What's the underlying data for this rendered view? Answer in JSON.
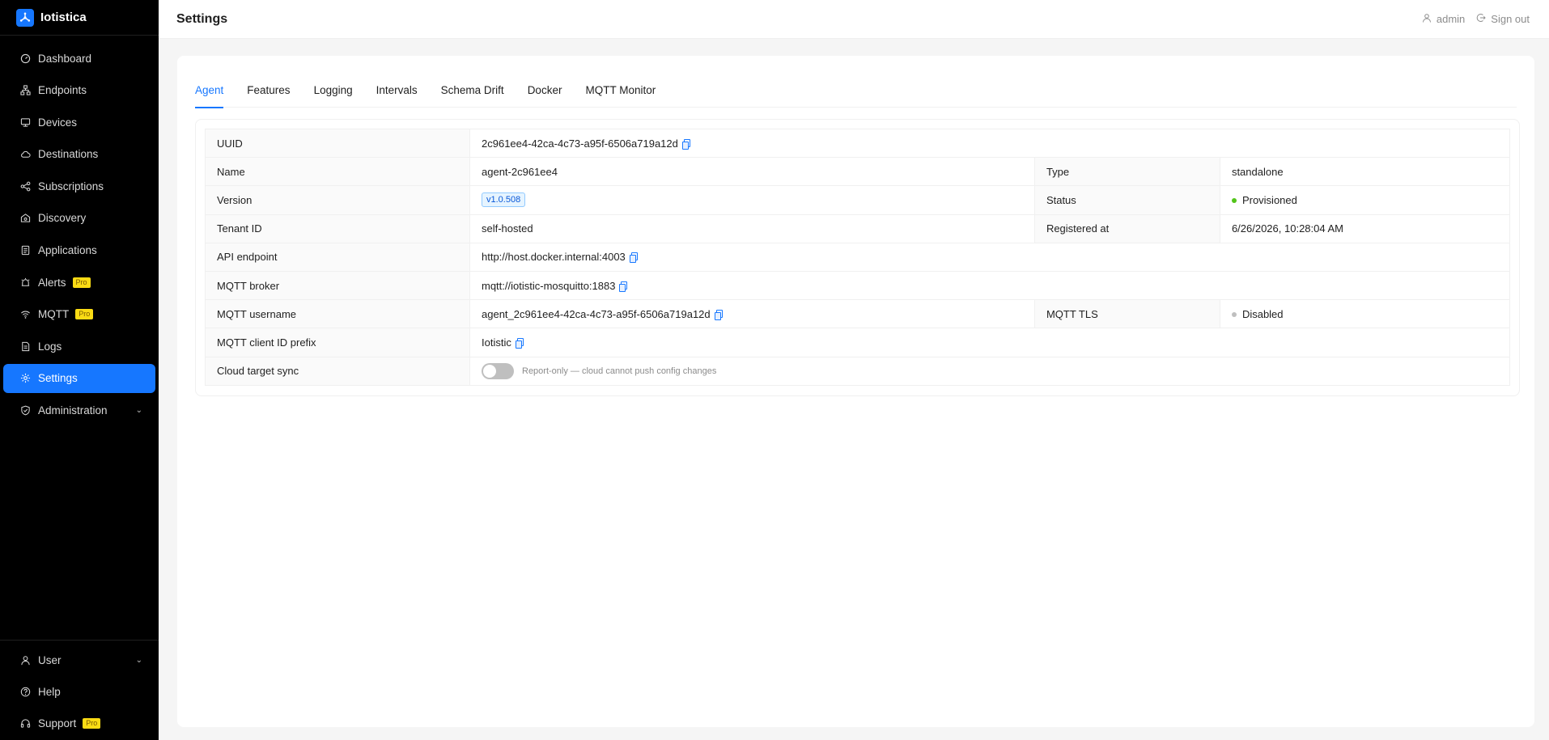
{
  "app": {
    "name": "Iotistica"
  },
  "sidebar": {
    "items": [
      {
        "label": "Dashboard",
        "icon": "dashboard-icon",
        "active": false
      },
      {
        "label": "Endpoints",
        "icon": "endpoints-icon",
        "active": false
      },
      {
        "label": "Devices",
        "icon": "devices-icon",
        "active": false
      },
      {
        "label": "Destinations",
        "icon": "cloud-icon",
        "active": false
      },
      {
        "label": "Subscriptions",
        "icon": "share-icon",
        "active": false
      },
      {
        "label": "Discovery",
        "icon": "discovery-icon",
        "active": false
      },
      {
        "label": "Applications",
        "icon": "applications-icon",
        "active": false
      },
      {
        "label": "Alerts",
        "icon": "alert-icon",
        "badge": "Pro",
        "active": false
      },
      {
        "label": "MQTT",
        "icon": "wifi-icon",
        "badge": "Pro",
        "active": false
      },
      {
        "label": "Logs",
        "icon": "logs-icon",
        "active": false
      },
      {
        "label": "Settings",
        "icon": "gear-icon",
        "active": true
      },
      {
        "label": "Administration",
        "icon": "shield-icon",
        "active": false,
        "expandable": true
      }
    ],
    "bottom": [
      {
        "label": "User",
        "icon": "user-icon",
        "expandable": true
      },
      {
        "label": "Help",
        "icon": "help-icon"
      },
      {
        "label": "Support",
        "icon": "headset-icon",
        "badge": "Pro"
      }
    ]
  },
  "header": {
    "title": "Settings",
    "user": "admin",
    "signout": "Sign out"
  },
  "tabs": [
    {
      "label": "Agent",
      "active": true
    },
    {
      "label": "Features",
      "active": false
    },
    {
      "label": "Logging",
      "active": false
    },
    {
      "label": "Intervals",
      "active": false
    },
    {
      "label": "Schema Drift",
      "active": false
    },
    {
      "label": "Docker",
      "active": false
    },
    {
      "label": "MQTT Monitor",
      "active": false
    }
  ],
  "agent": {
    "uuid_label": "UUID",
    "uuid": "2c961ee4-42ca-4c73-a95f-6506a719a12d",
    "name_label": "Name",
    "name": "agent-2c961ee4",
    "type_label": "Type",
    "type": "standalone",
    "version_label": "Version",
    "version": "v1.0.508",
    "status_label": "Status",
    "status": "Provisioned",
    "status_color": "#52c41a",
    "tenant_label": "Tenant ID",
    "tenant": "self-hosted",
    "registered_label": "Registered at",
    "registered": "6/26/2026, 10:28:04 AM",
    "api_label": "API endpoint",
    "api": "http://host.docker.internal:4003",
    "broker_label": "MQTT broker",
    "broker": "mqtt://iotistic-mosquitto:1883",
    "username_label": "MQTT username",
    "username": "agent_2c961ee4-42ca-4c73-a95f-6506a719a12d",
    "tls_label": "MQTT TLS",
    "tls": "Disabled",
    "tls_color": "#bfbfbf",
    "prefix_label": "MQTT client ID prefix",
    "prefix": "Iotistic",
    "sync_label": "Cloud target sync",
    "sync_enabled": false,
    "sync_hint": "Report-only — cloud cannot push config changes"
  }
}
